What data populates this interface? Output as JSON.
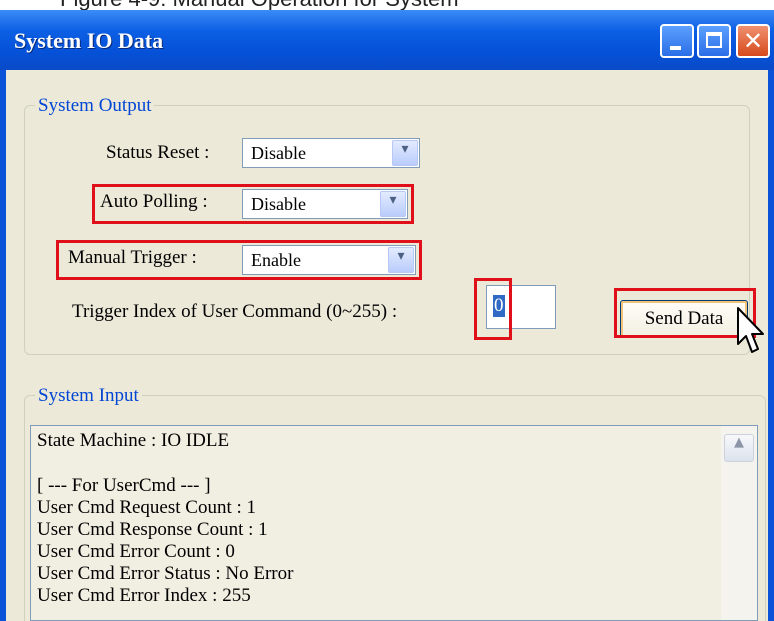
{
  "background_caption": "Figure 4-9: Manual Operation for System",
  "window": {
    "title": "System IO Data",
    "controls": {
      "minimize": "minimize-icon",
      "maximize": "maximize-icon",
      "close": "close-icon",
      "close_glyph": "✕"
    }
  },
  "system_output": {
    "group_title": "System Output",
    "status_reset": {
      "label": "Status Reset :",
      "value": "Disable"
    },
    "auto_polling": {
      "label": "Auto Polling :",
      "value": "Disable"
    },
    "manual_trigger": {
      "label": "Manual Trigger :",
      "value": "Enable"
    },
    "trigger_index": {
      "label": "Trigger Index of User Command (0~255) :",
      "value": "0"
    },
    "send_button": "Send Data",
    "dropdown_glyph": "▾"
  },
  "system_input": {
    "group_title": "System Input",
    "lines": [
      "State Machine : IO IDLE",
      "",
      "[ --- For UserCmd --- ]",
      "User Cmd Request Count : 1",
      "User Cmd Response Count : 1",
      "User Cmd Error Count : 0",
      "User Cmd Error Status : No Error",
      "User Cmd Error Index : 255"
    ],
    "scroll_up_glyph": "▲"
  },
  "colors": {
    "titlebar": "#0551d8",
    "client": "#ece9d8",
    "group_title": "#0046d5",
    "highlight": "#e0101a"
  }
}
